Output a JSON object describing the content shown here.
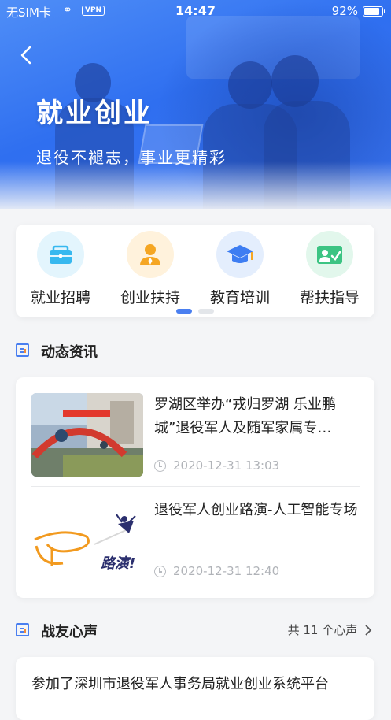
{
  "status_bar": {
    "carrier": "无SIM卡",
    "vpn": "VPN",
    "time": "14:47",
    "battery": "92%"
  },
  "hero": {
    "title": "就业创业",
    "subtitle": "退役不褪志，事业更精彩"
  },
  "services": [
    {
      "label": "就业招聘",
      "icon": "briefcase-icon",
      "color": "#36b8ef",
      "bg": "#e3f5fd"
    },
    {
      "label": "创业扶持",
      "icon": "person-tie-icon",
      "color": "#f5a623",
      "bg": "#fff2dc"
    },
    {
      "label": "教育培训",
      "icon": "graduation-cap-icon",
      "color": "#3d7df2",
      "bg": "#e4eefd"
    },
    {
      "label": "帮扶指导",
      "icon": "assist-user-icon",
      "color": "#3cc483",
      "bg": "#e2f7ec"
    }
  ],
  "news": {
    "section_title": "动态资讯",
    "items": [
      {
        "title": "罗湖区举办“戎归罗湖 乐业鹏城”退役军人及随军家属专…",
        "time": "2020-12-31 13:03"
      },
      {
        "title": "退役军人创业路演-人工智能专场",
        "time": "2020-12-31 12:40",
        "thumb_text": "路演!"
      }
    ]
  },
  "voices": {
    "section_title": "战友心声",
    "more": "共 11 个心声",
    "first_item": "参加了深圳市退役军人事务局就业创业系统平台"
  },
  "colors": {
    "accent": "#4a7ff0",
    "hero_blue": "#3a73ee"
  }
}
